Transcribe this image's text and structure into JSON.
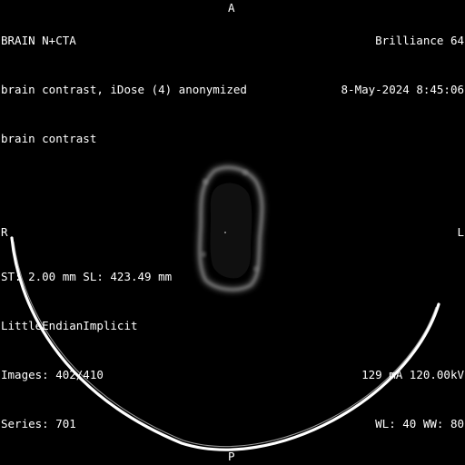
{
  "viewer": {
    "top_left": {
      "study": "BRAIN N+CTA",
      "series_description": "brain contrast, iDose (4) anonymized",
      "protocol": "brain contrast"
    },
    "top_right": {
      "scanner": "Brilliance 64",
      "datetime": "8-May-2024 8:45:06"
    },
    "bottom_left": {
      "slice_info": "ST: 2.00 mm SL: 423.49 mm",
      "transfer_syntax": "LittleEndianImplicit",
      "images": "Images: 402/410",
      "series": "Series: 701"
    },
    "bottom_right": {
      "exposure": "129 mA 120.00kV",
      "window": "WL: 40 WW: 80"
    },
    "orientation": {
      "top": "A",
      "bottom": "P",
      "left": "R",
      "right": "L"
    }
  },
  "colors": {
    "background": "#000000",
    "text": "#ffffff",
    "table_arc": "#ffffff",
    "tissue": "#9a9a9a"
  }
}
